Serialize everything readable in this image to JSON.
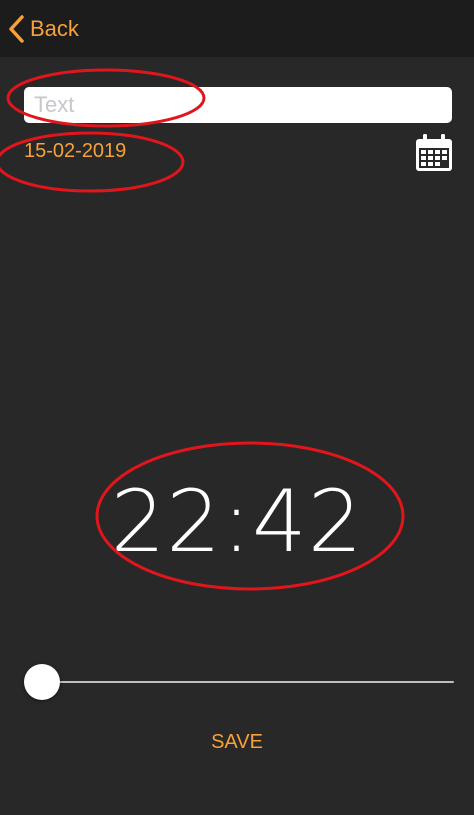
{
  "navbar": {
    "back_label": "Back",
    "back_icon": "chevron-left-icon"
  },
  "form": {
    "text_placeholder": "Text",
    "text_value": "",
    "date": "15-02-2019",
    "calendar_icon": "calendar-icon"
  },
  "time": {
    "display": "22:42"
  },
  "slider": {
    "value": 0.0
  },
  "actions": {
    "save_label": "SAVE"
  },
  "colors": {
    "background": "#282828",
    "navbar": "#1c1c1c",
    "accent": "#f7a13a",
    "annotation": "#e0161c"
  }
}
